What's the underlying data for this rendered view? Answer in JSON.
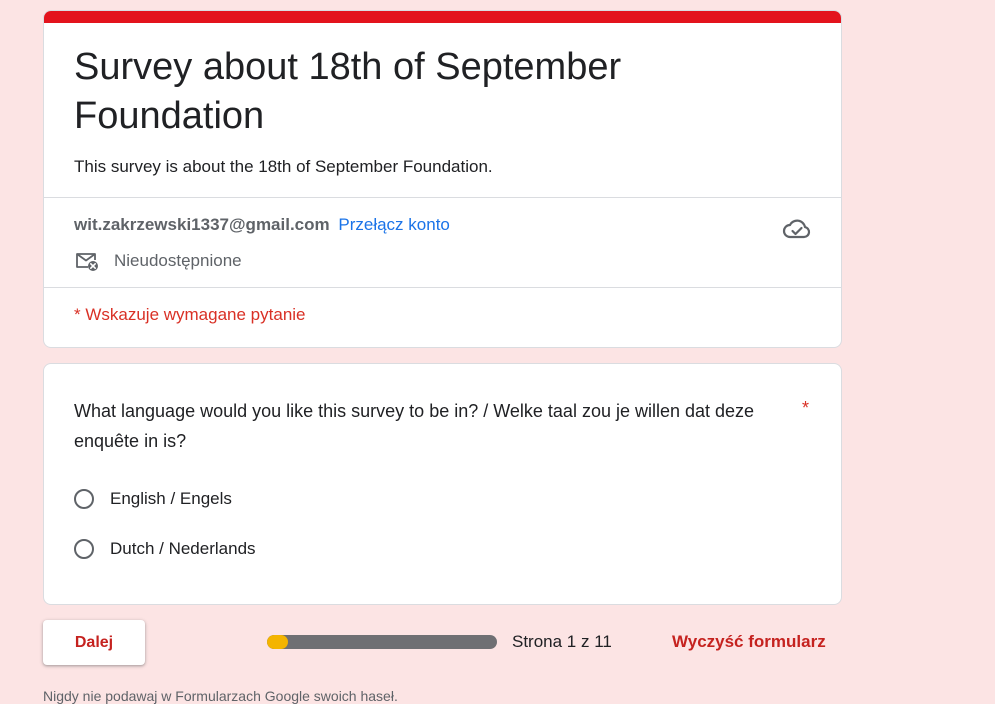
{
  "colors": {
    "background": "#fce4e4",
    "accent": "#e3131d",
    "link": "#1a73e8",
    "required": "#d93025",
    "progress_fill": "#f4b400",
    "progress_track": "#6f6f73"
  },
  "header": {
    "title": "Survey about 18th of September Foundation",
    "description": "This survey is about the 18th of September Foundation.",
    "account_email": "wit.zakrzewski1337@gmail.com",
    "switch_account_label": "Przełącz konto",
    "saved_icon": "cloud-done-icon",
    "not_shared_icon": "mail-off-icon",
    "not_shared_label": "Nieudostępnione",
    "required_note": "* Wskazuje wymagane pytanie"
  },
  "question": {
    "text": "What language would you like this survey to be in? / Welke taal zou je willen dat deze enquête in is?",
    "required_marker": "*",
    "options": [
      {
        "label": "English / Engels",
        "selected": false
      },
      {
        "label": "Dutch / Nederlands",
        "selected": false
      }
    ]
  },
  "footer": {
    "next_button_label": "Dalej",
    "progress_fraction": 0.09,
    "page_indicator": "Strona 1 z 11",
    "clear_form_label": "Wyczyść formularz",
    "password_warning": "Nigdy nie podawaj w Formularzach Google swoich haseł."
  }
}
